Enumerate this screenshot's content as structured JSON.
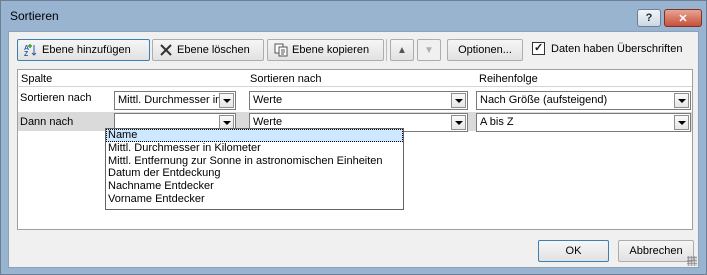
{
  "window": {
    "title": "Sortieren",
    "help_label": "?",
    "close_label": "✕"
  },
  "toolbar": {
    "add_label": "Ebene hinzufügen",
    "delete_label": "Ebene löschen",
    "copy_label": "Ebene kopieren",
    "up_label": "▲",
    "down_label": "▼",
    "options_label": "Optionen...",
    "headers_checkbox_label": "Daten haben Überschriften",
    "headers_checked": true
  },
  "columns": {
    "col": "Spalte",
    "sort_on": "Sortieren nach",
    "order": "Reihenfolge"
  },
  "rows": [
    {
      "label": "Sortieren nach",
      "column": "Mittl. Durchmesser in Kilometer",
      "sort_on": "Werte",
      "order": "Nach Größe (aufsteigend)"
    },
    {
      "label": "Dann nach",
      "column": "",
      "sort_on": "Werte",
      "order": "A bis Z"
    }
  ],
  "dropdown": {
    "options": [
      "Name",
      "Mittl. Durchmesser in Kilometer",
      "Mittl. Entfernung zur Sonne in astronomischen Einheiten",
      "Datum der Entdeckung",
      "Nachname Entdecker",
      "Vorname Entdecker"
    ],
    "selected_index": 0
  },
  "footer": {
    "ok_label": "OK",
    "cancel_label": "Abbrechen"
  }
}
